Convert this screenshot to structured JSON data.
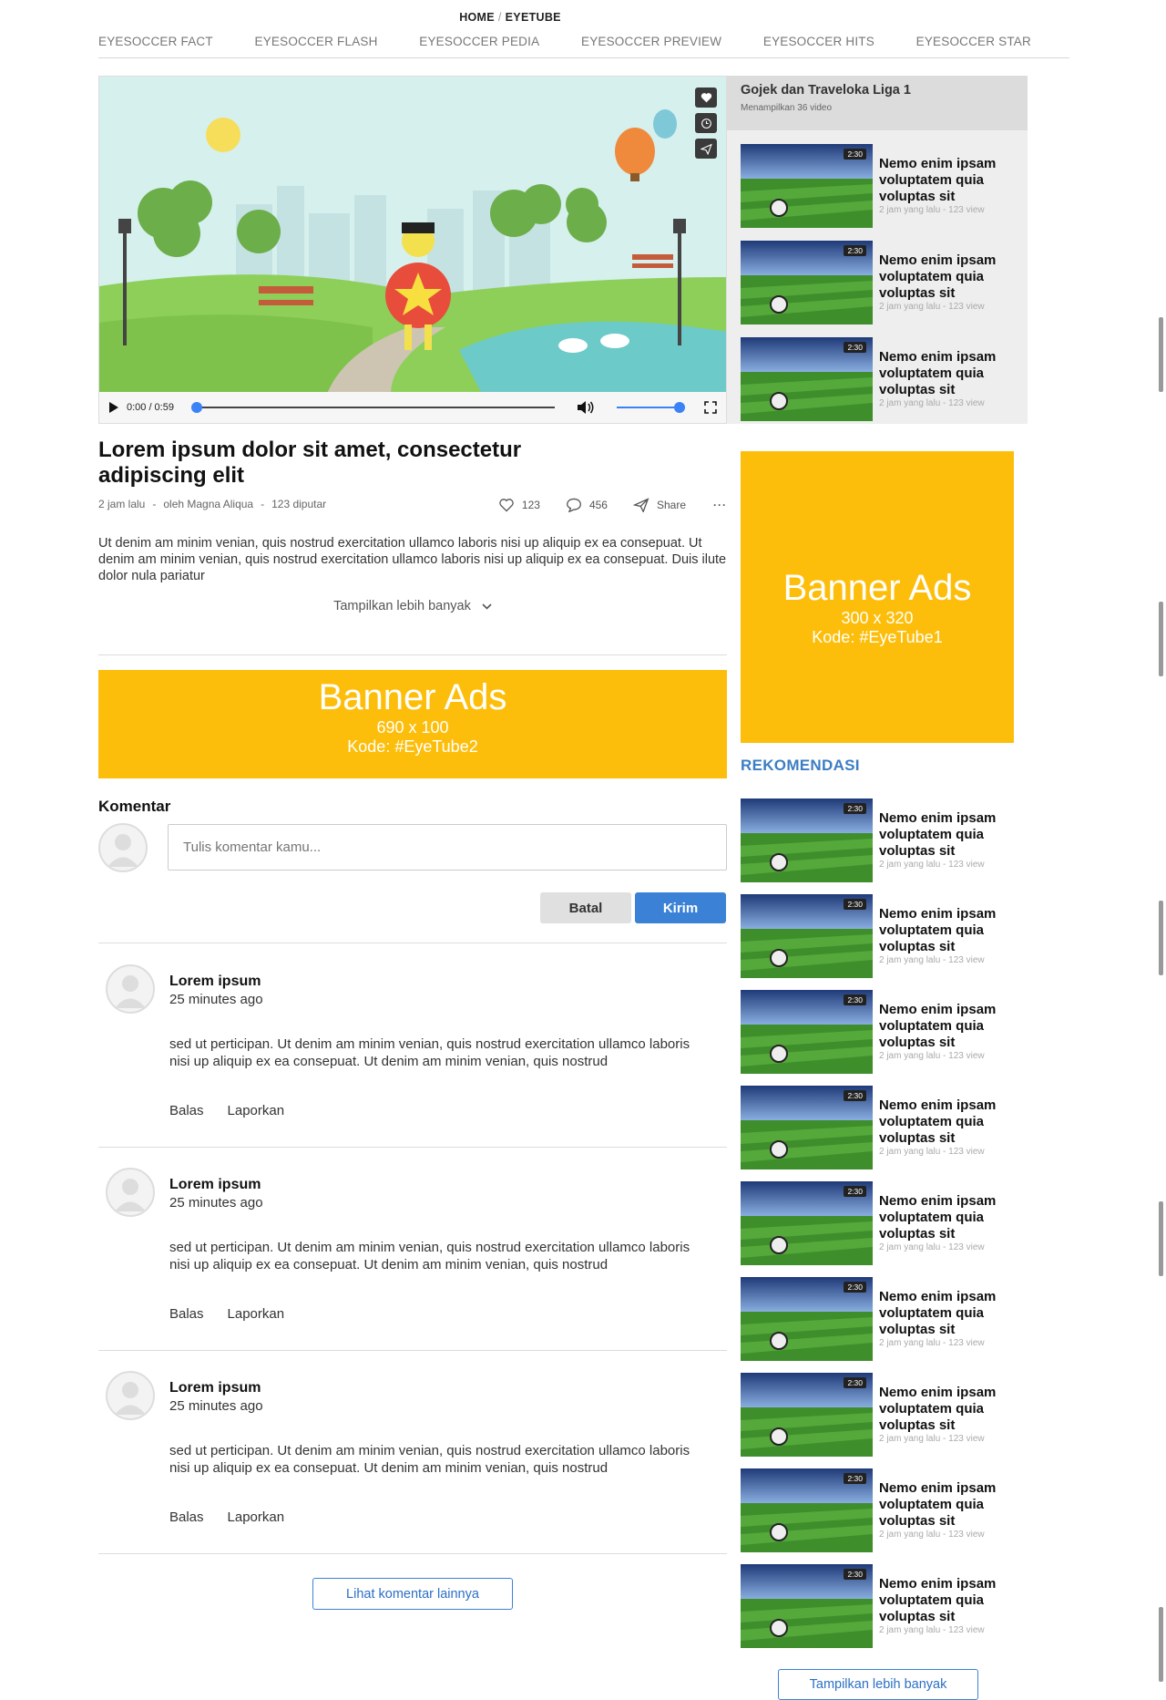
{
  "breadcrumb": {
    "home": "HOME",
    "sep": "/",
    "current": "EYETUBE"
  },
  "nav": [
    "EYESOCCER FACT",
    "EYESOCCER FLASH",
    "EYESOCCER PEDIA",
    "EYESOCCER PREVIEW",
    "EYESOCCER HITS",
    "EYESOCCER STAR"
  ],
  "player": {
    "time": "0:00 / 0:59",
    "progress": 0,
    "volume": 1
  },
  "playlist": {
    "title": "Gojek dan Traveloka Liga 1",
    "subtitle": "Menampilkan 36 video",
    "items": [
      {
        "duration": "2:30",
        "title": "Nemo enim ipsam voluptatem quia voluptas sit",
        "time": "2 jam yang lalu",
        "views": "123 view"
      },
      {
        "duration": "2:30",
        "title": "Nemo enim ipsam voluptatem quia voluptas sit",
        "time": "2 jam yang lalu",
        "views": "123 view"
      },
      {
        "duration": "2:30",
        "title": "Nemo enim ipsam voluptatem quia voluptas sit",
        "time": "2 jam yang lalu",
        "views": "123 view"
      }
    ]
  },
  "article": {
    "title": "Lorem ipsum dolor sit amet, consectetur adipiscing elit",
    "time": "2 jam lalu",
    "author": "oleh Magna Aliqua",
    "plays": "123 diputar",
    "likes": "123",
    "comments": "456",
    "share": "Share",
    "description": "Ut denim am minim venian, quis nostrud exercitation ullamco laboris nisi up aliquip ex ea consepuat. Ut denim am minim venian, quis nostrud exercitation ullamco laboris nisi up aliquip ex ea consepuat. Duis ilute dolor nula pariatur",
    "show_more": "Tampilkan lebih banyak"
  },
  "banner_wide": {
    "title": "Banner Ads",
    "size": "690 x 100",
    "code": "Kode: #EyeTube2"
  },
  "banner_side": {
    "title": "Banner Ads",
    "size": "300 x 320",
    "code": "Kode: #EyeTube1"
  },
  "comments": {
    "heading": "Komentar",
    "placeholder": "Tulis komentar kamu...",
    "cancel": "Batal",
    "submit": "Kirim",
    "reply": "Balas",
    "report": "Laporkan",
    "more": "Lihat komentar lainnya",
    "items": [
      {
        "name": "Lorem ipsum",
        "time": "25 minutes ago",
        "text": "sed ut perticipan. Ut denim am minim venian, quis nostrud exercitation ullamco laboris nisi up aliquip ex ea consepuat. Ut denim am minim venian, quis nostrud"
      },
      {
        "name": "Lorem ipsum",
        "time": "25 minutes ago",
        "text": "sed ut perticipan. Ut denim am minim venian, quis nostrud exercitation ullamco laboris nisi up aliquip ex ea consepuat. Ut denim am minim venian, quis nostrud"
      },
      {
        "name": "Lorem ipsum",
        "time": "25 minutes ago",
        "text": "sed ut perticipan. Ut denim am minim venian, quis nostrud exercitation ullamco laboris nisi up aliquip ex ea consepuat. Ut denim am minim venian, quis nostrud"
      }
    ]
  },
  "rekomendasi": {
    "heading": "REKOMENDASI",
    "more": "Tampilkan lebih banyak",
    "items": [
      {
        "duration": "2:30",
        "title": "Nemo enim ipsam voluptatem quia voluptas sit",
        "time": "2 jam yang lalu",
        "views": "123 view"
      },
      {
        "duration": "2:30",
        "title": "Nemo enim ipsam voluptatem quia voluptas sit",
        "time": "2 jam yang lalu",
        "views": "123 view"
      },
      {
        "duration": "2:30",
        "title": "Nemo enim ipsam voluptatem quia voluptas sit",
        "time": "2 jam yang lalu",
        "views": "123 view"
      },
      {
        "duration": "2:30",
        "title": "Nemo enim ipsam voluptatem quia voluptas sit",
        "time": "2 jam yang lalu",
        "views": "123 view"
      },
      {
        "duration": "2:30",
        "title": "Nemo enim ipsam voluptatem quia voluptas sit",
        "time": "2 jam yang lalu",
        "views": "123 view"
      },
      {
        "duration": "2:30",
        "title": "Nemo enim ipsam voluptatem quia voluptas sit",
        "time": "2 jam yang lalu",
        "views": "123 view"
      },
      {
        "duration": "2:30",
        "title": "Nemo enim ipsam voluptatem quia voluptas sit",
        "time": "2 jam yang lalu",
        "views": "123 view"
      },
      {
        "duration": "2:30",
        "title": "Nemo enim ipsam voluptatem quia voluptas sit",
        "time": "2 jam yang lalu",
        "views": "123 view"
      },
      {
        "duration": "2:30",
        "title": "Nemo enim ipsam voluptatem quia voluptas sit",
        "time": "2 jam yang lalu",
        "views": "123 view"
      }
    ]
  },
  "colors": {
    "accent": "#3b82d6",
    "banner": "#fdbe0b",
    "rekom_heading": "#3b7dc4"
  }
}
